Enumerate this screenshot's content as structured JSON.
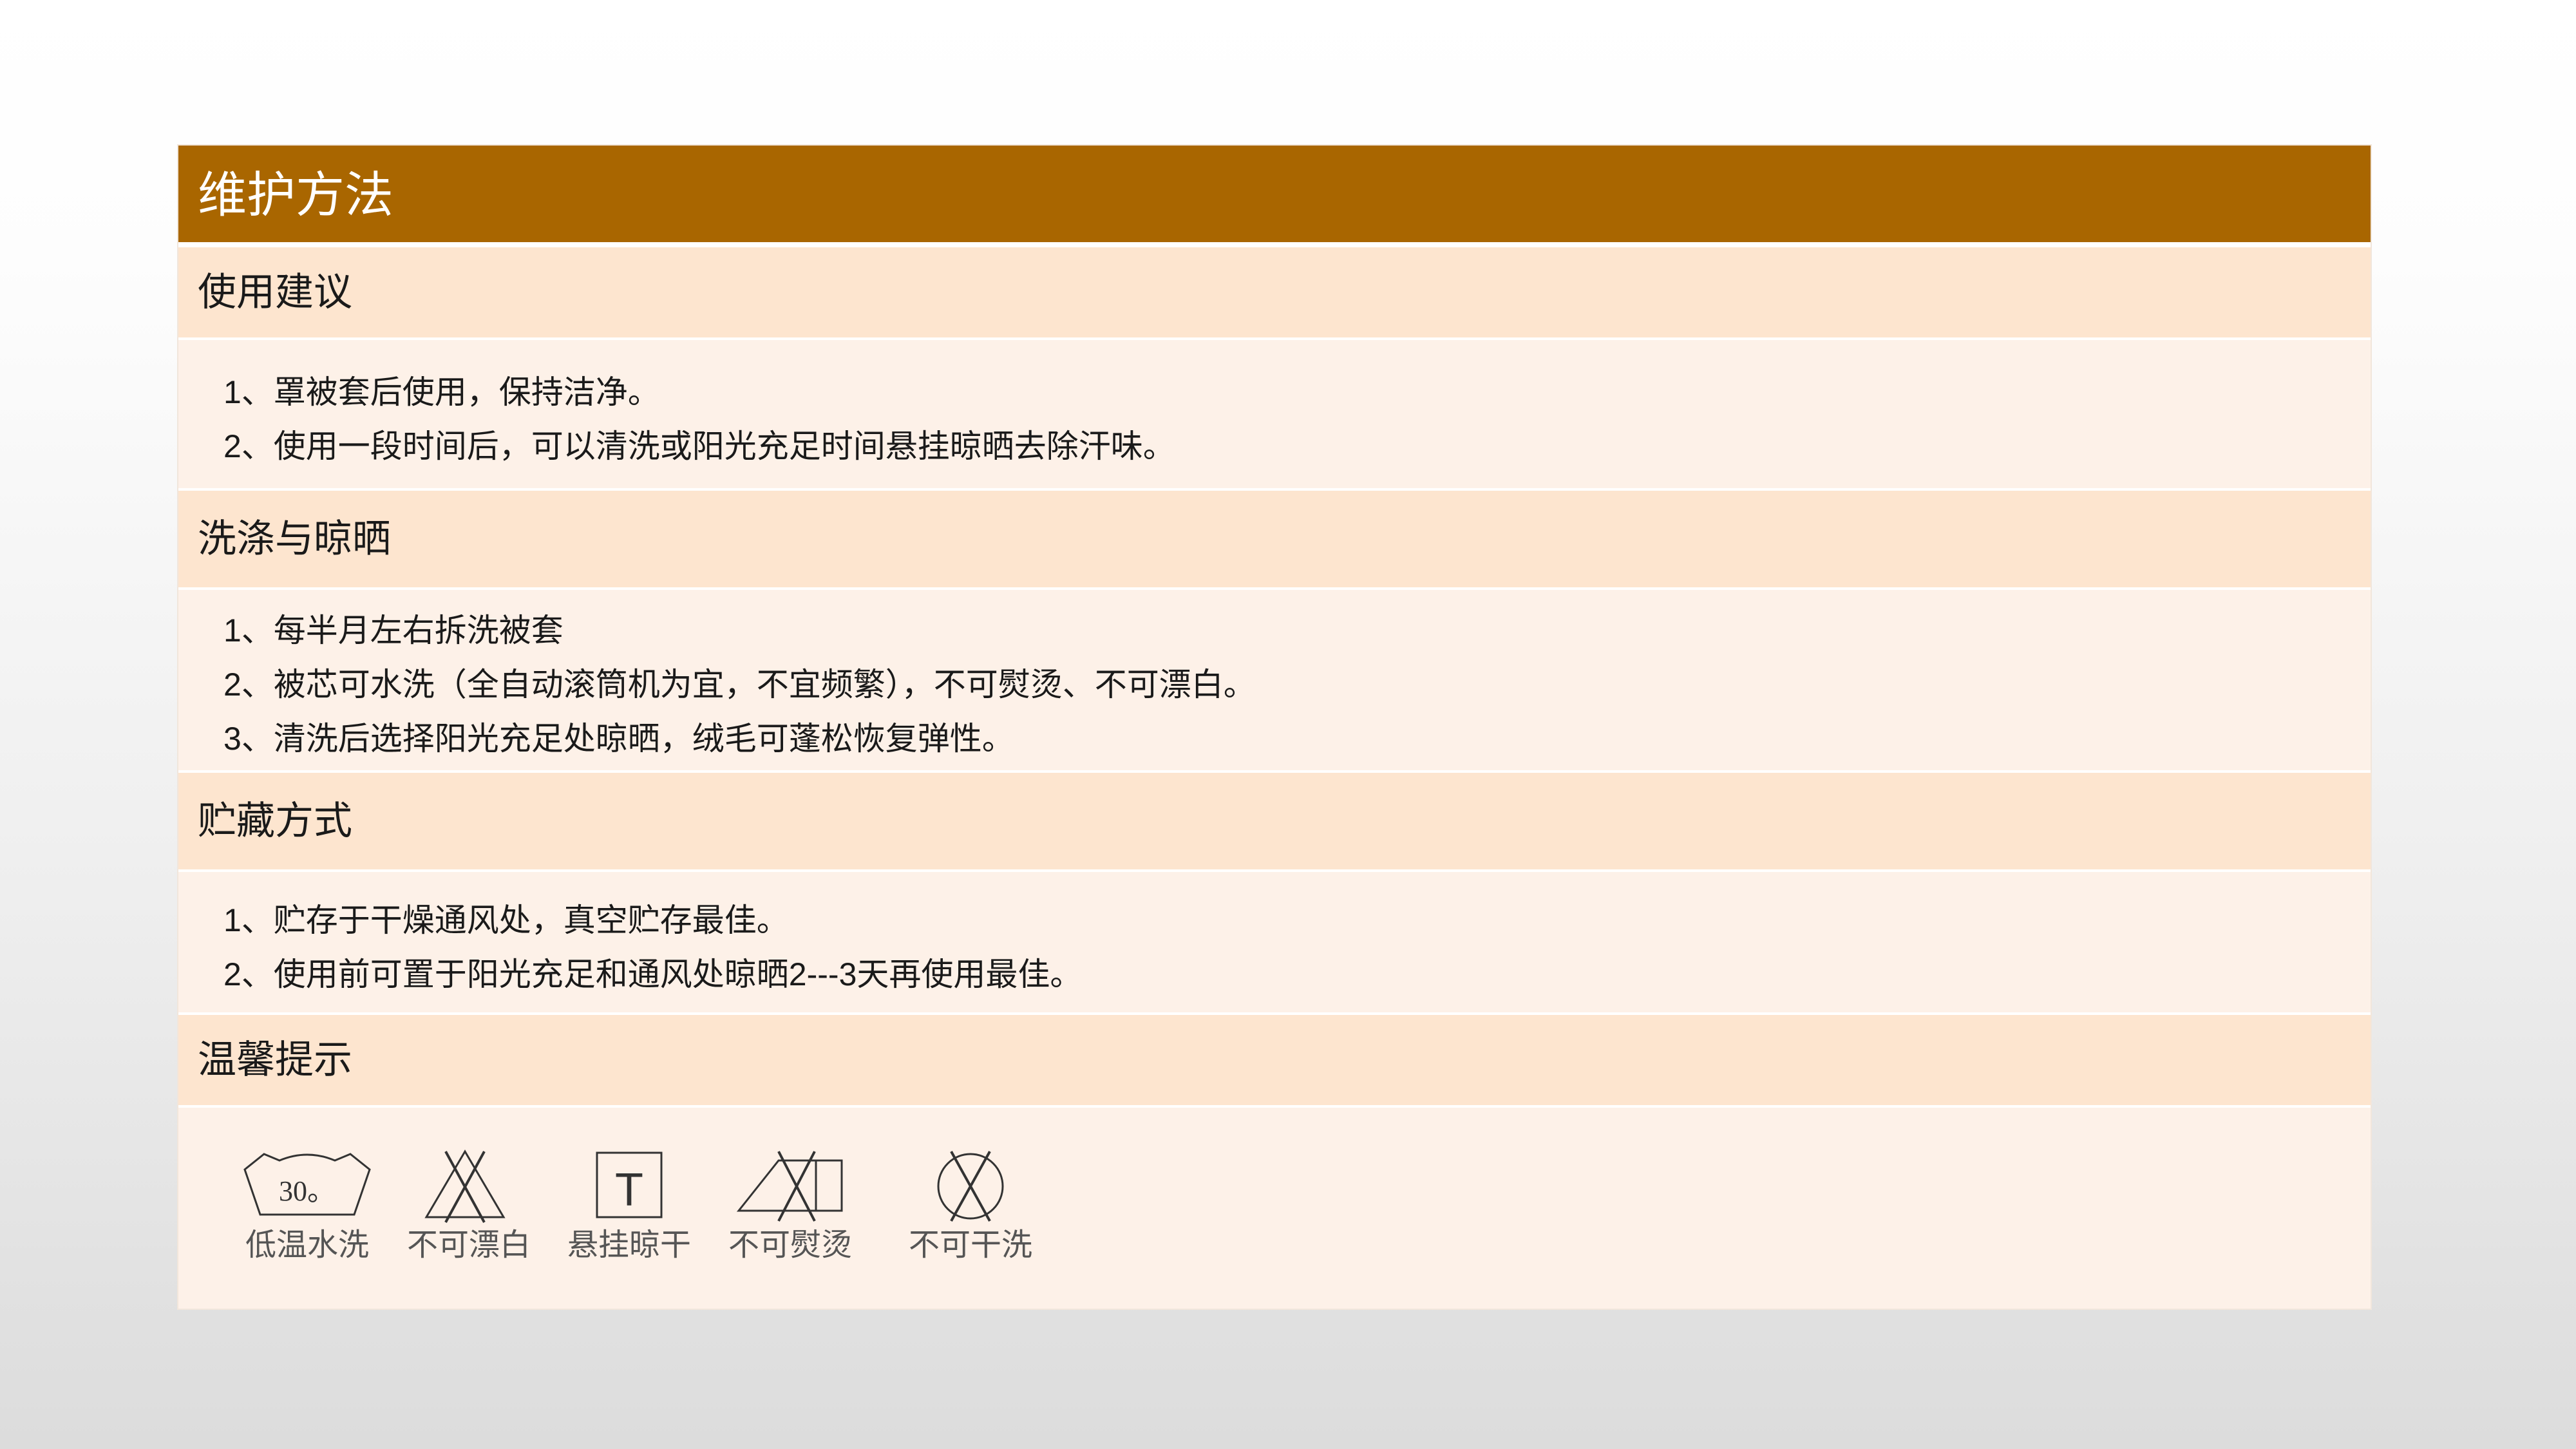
{
  "title": "维护方法",
  "sections": [
    {
      "heading": "使用建议",
      "lines": [
        "1、罩被套后使用，保持洁净。",
        "2、使用一段时间后，可以清洗或阳光充足时间悬挂晾晒去除汗味。"
      ]
    },
    {
      "heading": "洗涤与晾晒",
      "lines": [
        "1、每半月左右拆洗被套",
        "2、被芯可水洗（全自动滚筒机为宜，不宜频繁），不可熨烫、不可漂白。",
        "3、清洗后选择阳光充足处晾晒，绒毛可蓬松恢复弹性。"
      ]
    },
    {
      "heading": "贮藏方式",
      "lines": [
        "1、贮存于干燥通风处，真空贮存最佳。",
        "2、使用前可置于阳光充足和通风处晾晒2---3天再使用最佳。"
      ]
    },
    {
      "heading": "温馨提示",
      "care_symbols": [
        {
          "label": "低温水洗",
          "icon": "wash-30-icon",
          "temp": "30。"
        },
        {
          "label": "不可漂白",
          "icon": "no-bleach-icon"
        },
        {
          "label": "悬挂晾干",
          "icon": "hang-dry-icon",
          "mark": "T"
        },
        {
          "label": "不可熨烫",
          "icon": "no-iron-icon"
        },
        {
          "label": "不可干洗",
          "icon": "no-dry-clean-icon"
        }
      ]
    }
  ],
  "colors": {
    "title_bg": "#a96600",
    "header_bg": "#fde5cf",
    "body_bg": "#fdf1e8"
  }
}
